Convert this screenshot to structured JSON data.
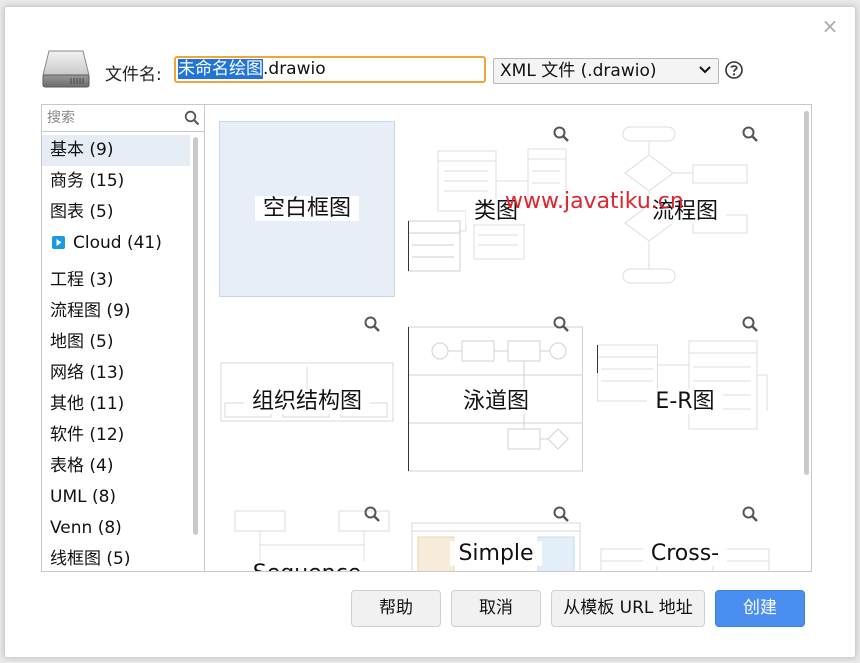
{
  "dialog": {
    "close_glyph": "×"
  },
  "file": {
    "label": "文件名:",
    "name_selected": "未命名绘图",
    "name_ext": ".drawio",
    "type_value": "XML 文件 (.drawio)"
  },
  "sidebar": {
    "search_placeholder": "搜索",
    "categories": [
      {
        "label": "基本 (9)"
      },
      {
        "label": "商务 (15)"
      },
      {
        "label": "图表 (5)"
      },
      {
        "label": "Cloud (41)"
      },
      {
        "label": "工程 (3)"
      },
      {
        "label": "流程图 (9)"
      },
      {
        "label": "地图 (5)"
      },
      {
        "label": "网络 (13)"
      },
      {
        "label": "其他 (11)"
      },
      {
        "label": "软件 (12)"
      },
      {
        "label": "表格 (4)"
      },
      {
        "label": "UML (8)"
      },
      {
        "label": "Venn (8)"
      },
      {
        "label": "线框图 (5)"
      }
    ]
  },
  "templates": [
    {
      "label": "空白框图"
    },
    {
      "label": "类图"
    },
    {
      "label": "流程图"
    },
    {
      "label": "组织结构图"
    },
    {
      "label": "泳道图"
    },
    {
      "label": "E-R图"
    },
    {
      "label": "Sequence"
    },
    {
      "label": "Simple"
    },
    {
      "label": "Cross-"
    }
  ],
  "watermark": "www.javatiku.cn",
  "buttons": {
    "help": "帮助",
    "cancel": "取消",
    "from_url": "从模板 URL 地址",
    "create": "创建"
  },
  "colors": {
    "accent": "#4a8ef0",
    "input_focus": "#f2a33a",
    "selection": "#1f74d6",
    "watermark": "#e0242f"
  }
}
